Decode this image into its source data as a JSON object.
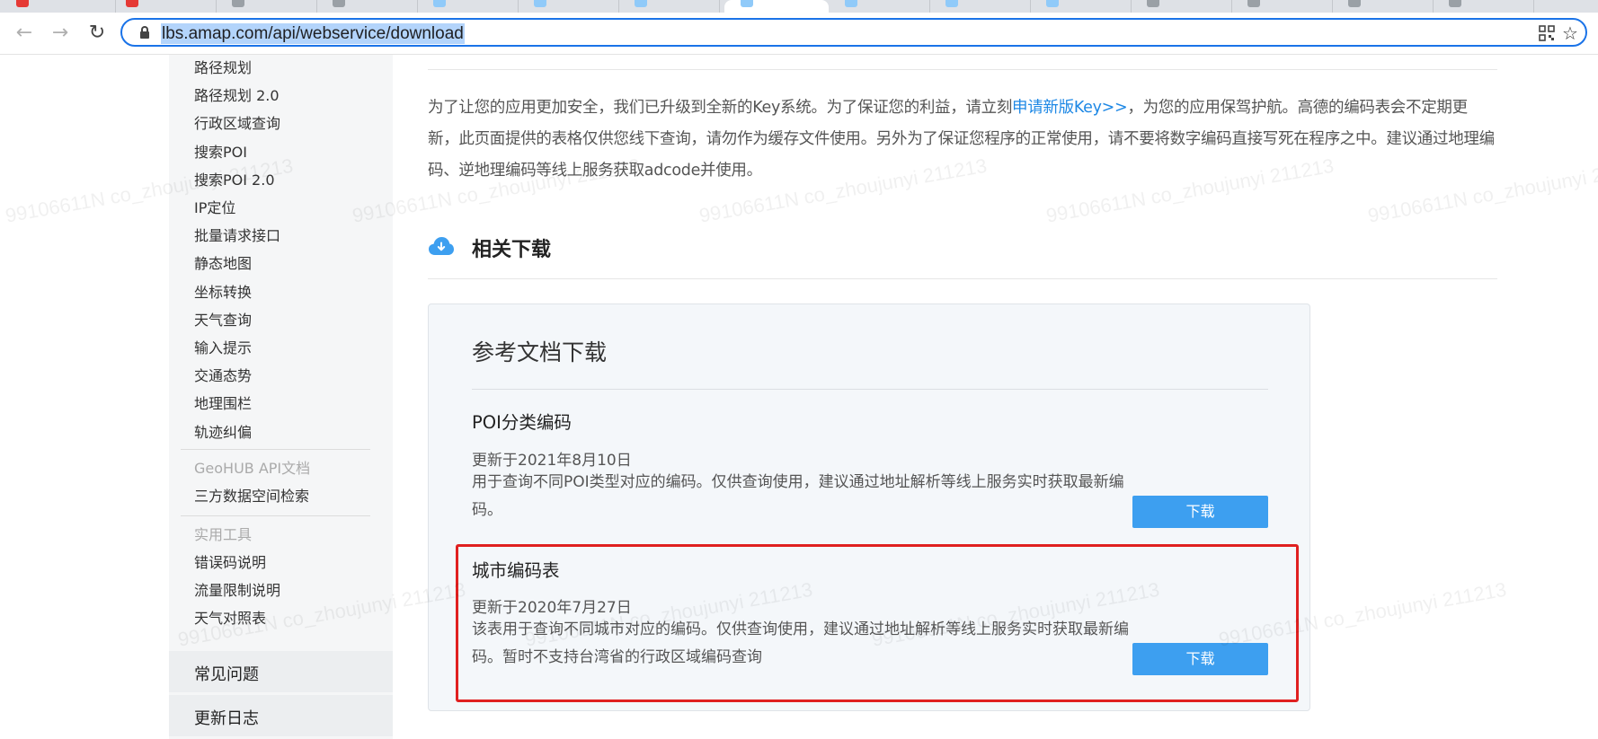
{
  "browser": {
    "url": "lbs.amap.com/api/webservice/download"
  },
  "sidebar": {
    "items_top": [
      "路径规划",
      "路径规划 2.0",
      "行政区域查询",
      "搜索POI",
      "搜索POI 2.0",
      "IP定位",
      "批量请求接口",
      "静态地图",
      "坐标转换",
      "天气查询",
      "输入提示",
      "交通态势",
      "地理围栏",
      "轨迹纠偏"
    ],
    "group_geohub": "GeoHUB API文档",
    "item_geohub": "三方数据空间检索",
    "group_tools": "实用工具",
    "items_tools": [
      "错误码说明",
      "流量限制说明",
      "天气对照表"
    ],
    "section_faq": "常见问题",
    "section_changelog": "更新日志"
  },
  "main": {
    "intro_part1": "为了让您的应用更加安全，我们已升级到全新的Key系统。为了保证您的利益，请立刻",
    "intro_link": "申请新版Key>>",
    "intro_part2": "，为您的应用保驾护航。高德的编码表会不定期更新，此页面提供的表格仅供您线下查询，请勿作为缓存文件使用。另外为了保证您程序的正常使用，请不要将数字编码直接写死在程序之中。建议通过地理编码、逆地理编码等线上服务获取adcode并使用。",
    "section_title": "相关下载",
    "panel_title": "参考文档下载",
    "docs": [
      {
        "name": "POI分类编码",
        "date": "更新于2021年8月10日",
        "desc": "用于查询不同POI类型对应的编码。仅供查询使用，建议通过地址解析等线上服务实时获取最新编码。",
        "button": "下载"
      },
      {
        "name": "城市编码表",
        "date": "更新于2020年7月27日",
        "desc": "该表用于查询不同城市对应的编码。仅供查询使用，建议通过地址解析等线上服务实时获取最新编码。暂时不支持台湾省的行政区域编码查询",
        "button": "下载"
      }
    ]
  },
  "watermark": "99106611N co_zhoujunyi 211213",
  "colors": {
    "accent": "#3d9ff0",
    "link": "#1e88e5",
    "highlight_border": "#e02020",
    "omnibox_border": "#1a73e8"
  }
}
